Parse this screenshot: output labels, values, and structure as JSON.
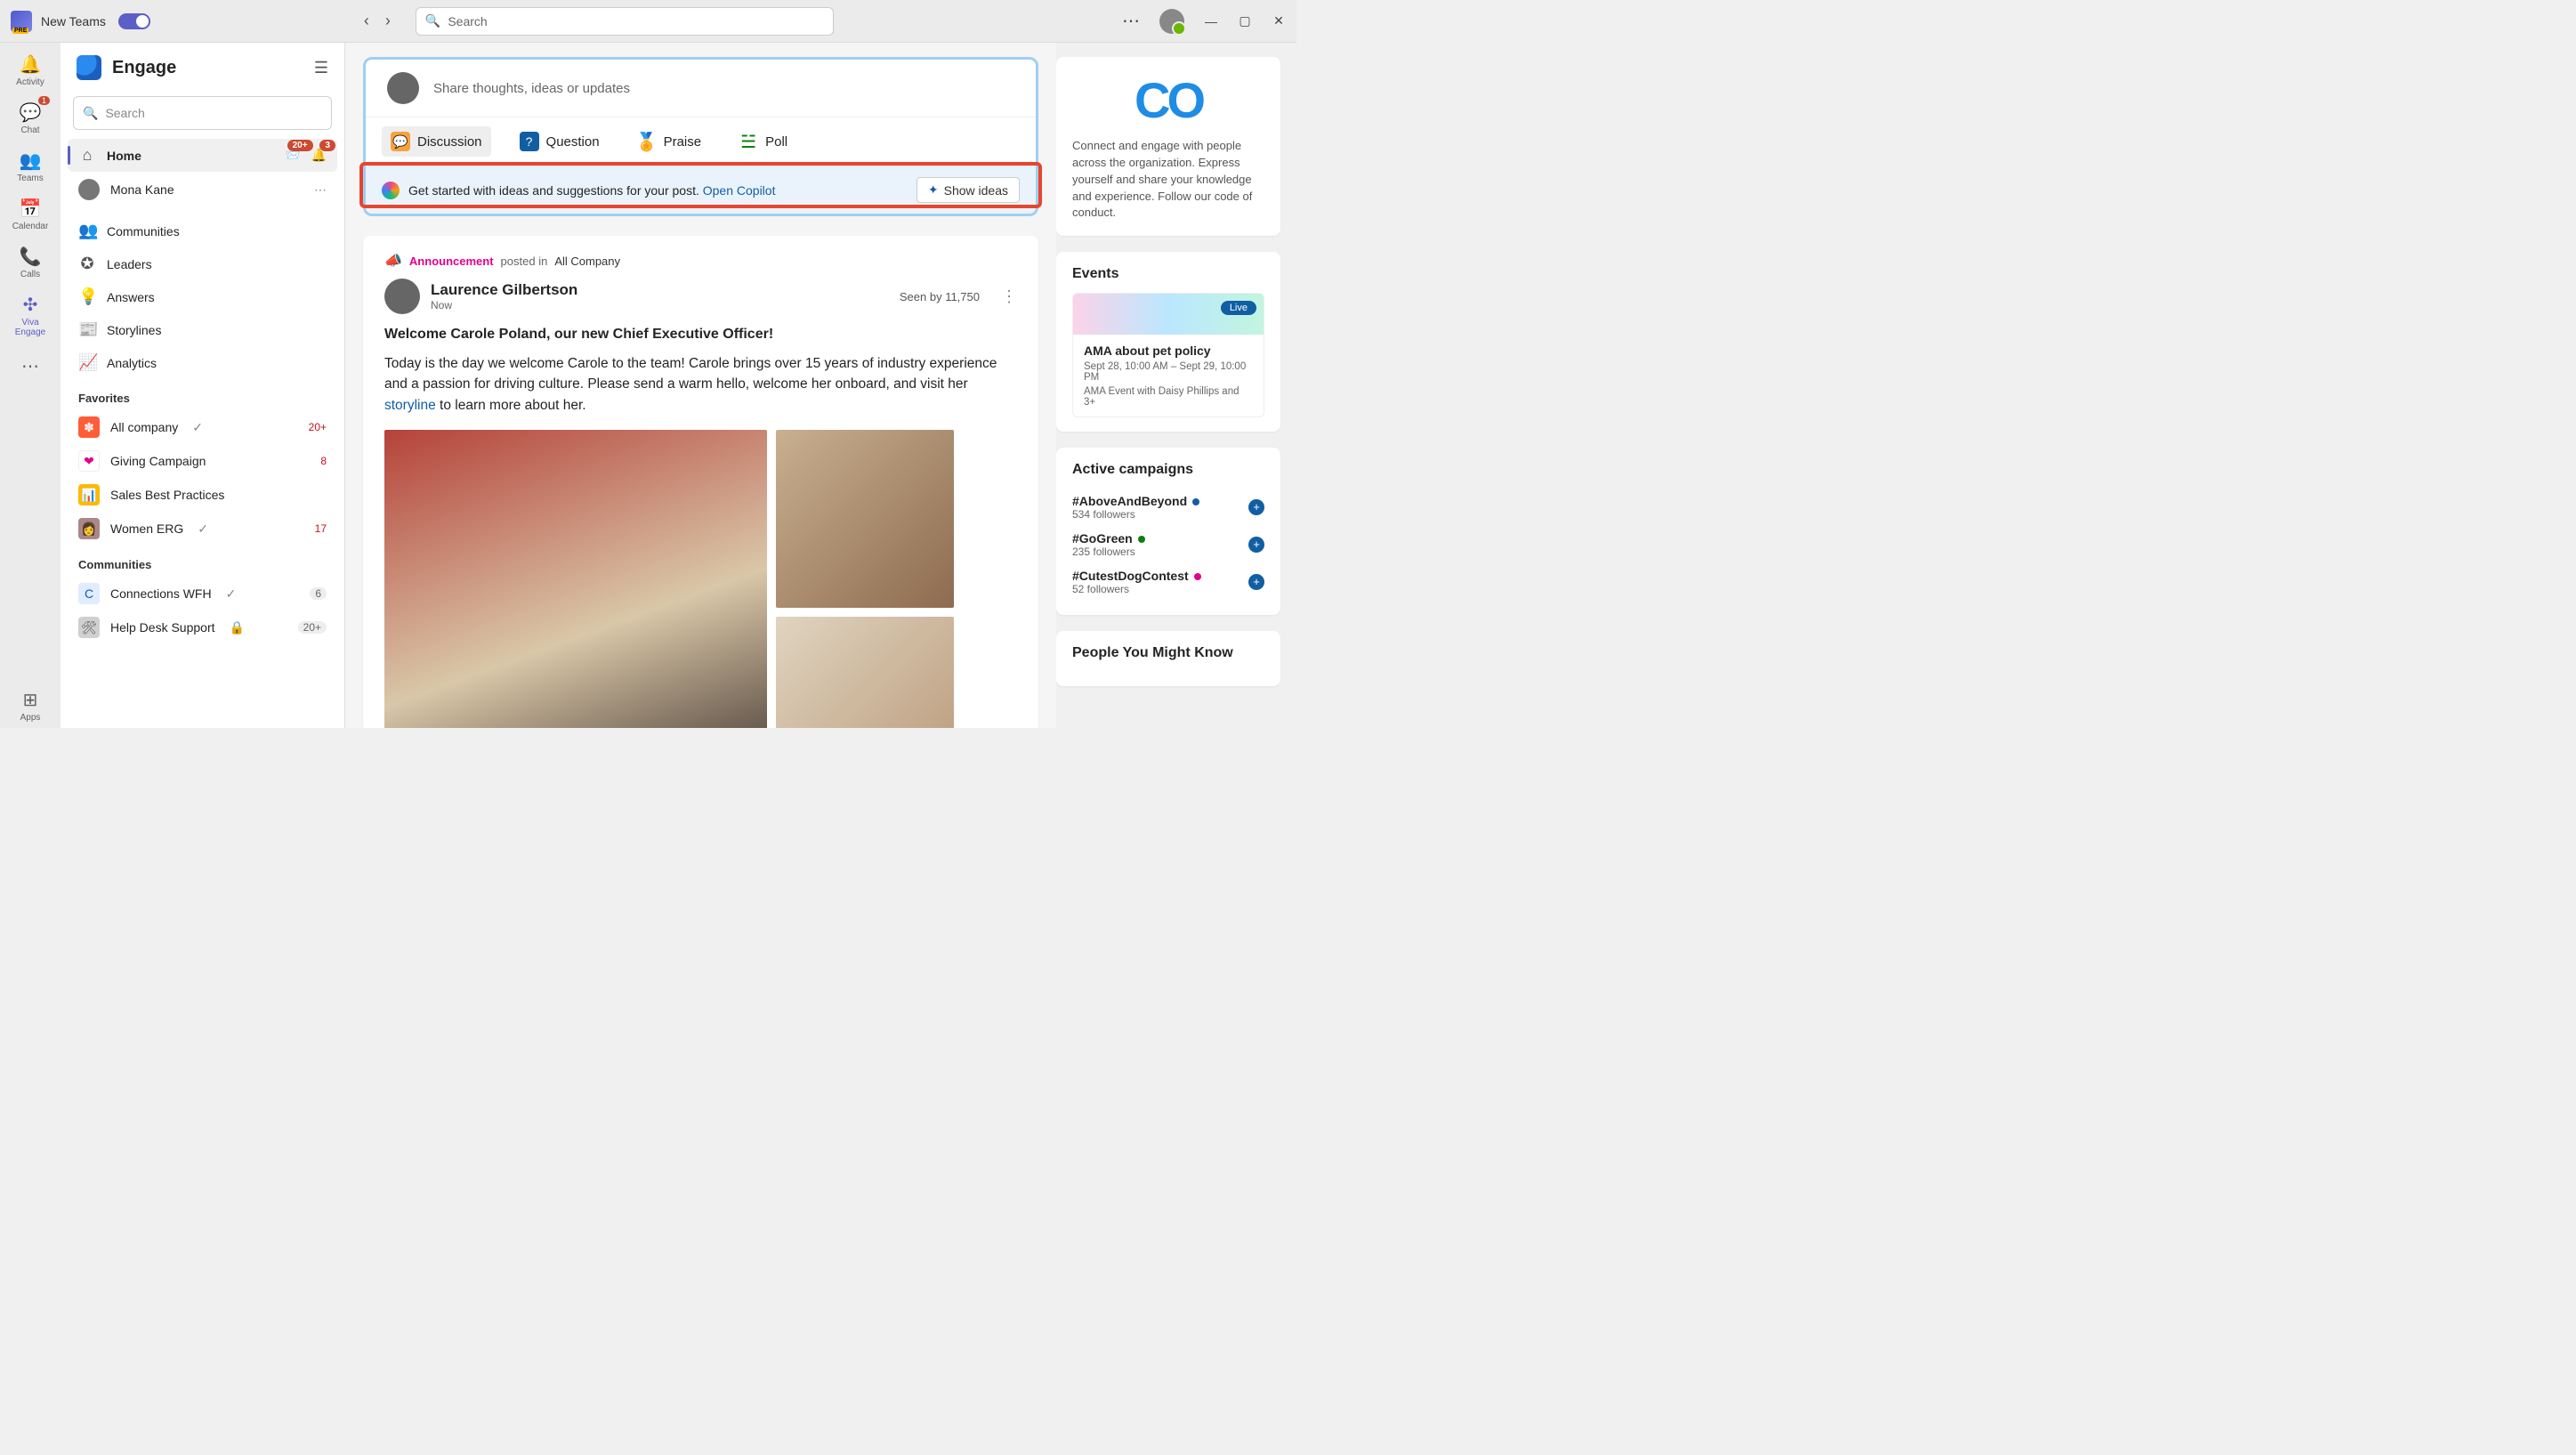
{
  "titlebar": {
    "app_name": "New Teams",
    "search_placeholder": "Search",
    "more": "⋯",
    "minimize": "—",
    "maximize": "▢",
    "close": "✕",
    "back": "‹",
    "forward": "›"
  },
  "rail": {
    "activity": "Activity",
    "chat": "Chat",
    "chat_badge": "1",
    "teams": "Teams",
    "calendar": "Calendar",
    "calls": "Calls",
    "engage": "Viva Engage",
    "apps": "Apps"
  },
  "engage": {
    "title": "Engage",
    "search_placeholder": "Search",
    "nav": {
      "home": "Home",
      "inbox_badge": "20+",
      "bell_badge": "3",
      "user": "Mona Kane",
      "communities": "Communities",
      "leaders": "Leaders",
      "answers": "Answers",
      "storylines": "Storylines",
      "analytics": "Analytics"
    },
    "favorites_title": "Favorites",
    "favorites": [
      {
        "name": "All company",
        "count": "20+",
        "color": "#ff5c39",
        "glyph": "✽"
      },
      {
        "name": "Giving Campaign",
        "count": "8",
        "color": "#ffffff",
        "glyph": "❤"
      },
      {
        "name": "Sales Best Practices",
        "count": "",
        "color": "#ffb900",
        "glyph": "📊"
      },
      {
        "name": "Women ERG",
        "count": "17",
        "color": "#888",
        "glyph": "👩"
      }
    ],
    "communities_title": "Communities",
    "communities": [
      {
        "name": "Connections WFH",
        "count": "6",
        "color": "#e0ecff",
        "glyph": "C"
      },
      {
        "name": "Help Desk Support",
        "count": "20+",
        "color": "#d0d0d0",
        "glyph": "🛠"
      }
    ]
  },
  "composer": {
    "placeholder": "Share thoughts, ideas or updates",
    "tabs": {
      "discussion": "Discussion",
      "question": "Question",
      "praise": "Praise",
      "poll": "Poll"
    },
    "copilot_text": "Get started with ideas and suggestions for your post. ",
    "copilot_link": "Open Copilot",
    "show_ideas": "Show ideas"
  },
  "post": {
    "ann_label": "Announcement",
    "posted_in": "posted in",
    "community": "All Company",
    "author": "Laurence Gilbertson",
    "time": "Now",
    "seen": "Seen by 11,750",
    "title": "Welcome Carole Poland, our new Chief Executive Officer!",
    "body_1": "Today is the day we welcome Carole to the team! Carole brings over 15 years of industry experience and a passion for driving culture. Please send a warm hello, welcome her onboard, and visit her ",
    "body_link": "storyline",
    "body_2": " to learn more about her."
  },
  "right": {
    "co_logo": "CO",
    "co_text": "Connect and engage with people across the organization. Express yourself and share your knowledge and experience. Follow our code of conduct.",
    "events_title": "Events",
    "event": {
      "live": "Live",
      "title": "AMA about pet policy",
      "when": "Sept 28, 10:00 AM – Sept 29, 10:00 PM",
      "who": "AMA Event with Daisy Phillips and 3+"
    },
    "campaigns_title": "Active campaigns",
    "campaigns": [
      {
        "tag": "#AboveAndBeyond",
        "followers": "534 followers",
        "dot": "#115ea3"
      },
      {
        "tag": "#GoGreen",
        "followers": "235 followers",
        "dot": "#107c10"
      },
      {
        "tag": "#CutestDogContest",
        "followers": "52 followers",
        "dot": "#e3008c"
      }
    ],
    "people_title": "People You Might Know"
  }
}
